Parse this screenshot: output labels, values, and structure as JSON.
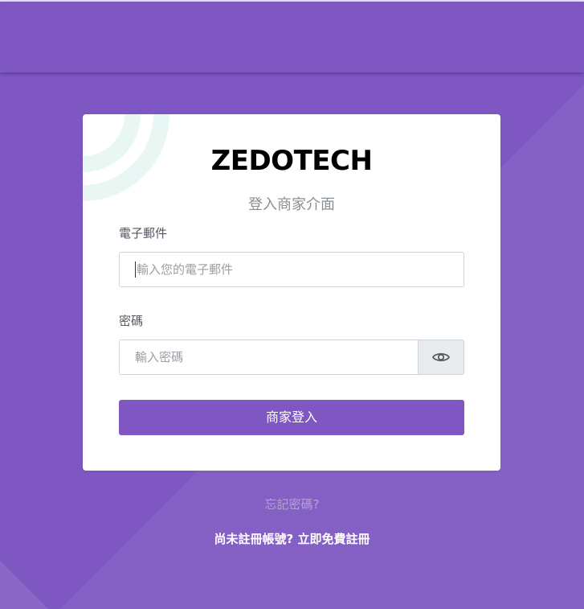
{
  "brand": {
    "logo_text": "ZEDOTECH"
  },
  "login": {
    "subtitle": "登入商家介面",
    "email_label": "電子郵件",
    "email_placeholder": "輸入您的電子郵件",
    "password_label": "密碼",
    "password_placeholder": "輸入密碼",
    "submit_label": "商家登入"
  },
  "footer": {
    "forgot_password": "忘記密碼?",
    "signup_prompt": "尚未註冊帳號? 立即免費註冊"
  },
  "colors": {
    "background": "#7e57c2",
    "primary_button": "#7e57c2",
    "card": "#ffffff",
    "decor_arc": "#e8f7f4"
  },
  "icons": {
    "password_toggle": "eye-icon"
  }
}
